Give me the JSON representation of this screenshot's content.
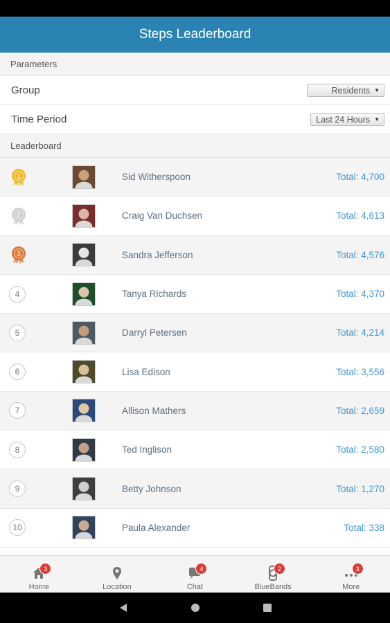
{
  "app_bar": {
    "title": "Steps Leaderboard"
  },
  "parameters": {
    "header": "Parameters",
    "group": {
      "label": "Group",
      "value": "Residents"
    },
    "time_period": {
      "label": "Time Period",
      "value": "Last 24 Hours"
    }
  },
  "leaderboard": {
    "header": "Leaderboard",
    "entries": [
      {
        "rank": "1",
        "medal": "gold",
        "name": "Sid Witherspoon",
        "total": "Total: 4,700"
      },
      {
        "rank": "2",
        "medal": "silver",
        "name": "Craig Van Duchsen",
        "total": "Total: 4,613"
      },
      {
        "rank": "3",
        "medal": "bronze",
        "name": "Sandra Jefferson",
        "total": "Total: 4,576"
      },
      {
        "rank": "4",
        "medal": "",
        "name": "Tanya Richards",
        "total": "Total: 4,370"
      },
      {
        "rank": "5",
        "medal": "",
        "name": "Darryl Petersen",
        "total": "Total: 4,214"
      },
      {
        "rank": "6",
        "medal": "",
        "name": "Lisa Edison",
        "total": "Total: 3,556"
      },
      {
        "rank": "7",
        "medal": "",
        "name": "Allison Mathers",
        "total": "Total: 2,659"
      },
      {
        "rank": "8",
        "medal": "",
        "name": "Ted Inglison",
        "total": "Total: 2,580"
      },
      {
        "rank": "9",
        "medal": "",
        "name": "Betty Johnson",
        "total": "Total: 1,270"
      },
      {
        "rank": "10",
        "medal": "",
        "name": "Paula Alexander",
        "total": "Total: 338"
      }
    ]
  },
  "tabs": [
    {
      "label": "Home",
      "icon": "home-icon",
      "badge": "3"
    },
    {
      "label": "Location",
      "icon": "location-pin-icon",
      "badge": ""
    },
    {
      "label": "Chat",
      "icon": "chat-icon",
      "badge": "4"
    },
    {
      "label": "BlueBands",
      "icon": "watch-icon",
      "badge": "2"
    },
    {
      "label": "More",
      "icon": "more-dots-icon",
      "badge": "3"
    }
  ],
  "colors": {
    "app_bar": "#2a83b3",
    "total_text": "#3f97d2",
    "badge": "#dd3a34",
    "gold": "#f1b92a",
    "silver": "#cfcfcf",
    "bronze": "#dd7a3a"
  }
}
